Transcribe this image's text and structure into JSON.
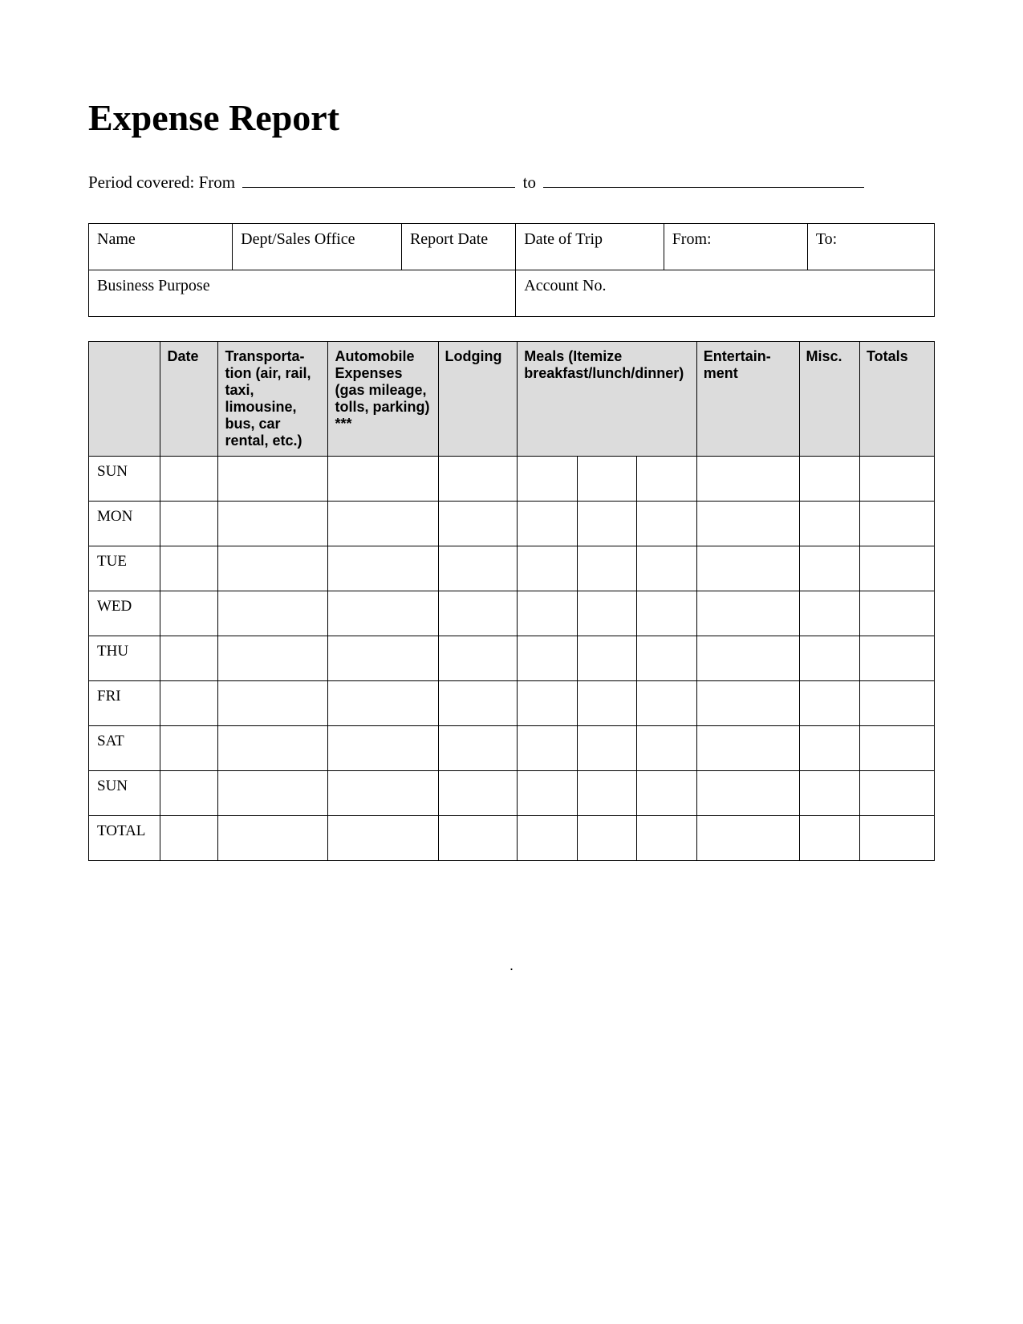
{
  "title": "Expense Report",
  "period": {
    "label_prefix": "Period covered: From",
    "label_to": "to"
  },
  "info_table": {
    "row1": {
      "name": "Name",
      "dept": "Dept/Sales Office",
      "report_date": "Report Date",
      "date_of_trip": "Date of Trip",
      "from": "From:",
      "to": "To:"
    },
    "row2": {
      "business_purpose": "Business Purpose",
      "account_no": "Account No."
    }
  },
  "expense_table": {
    "headers": {
      "blank": "",
      "date": "Date",
      "transportation": "Transporta-tion (air, rail, taxi, limousine, bus, car rental, etc.)",
      "automobile": "Automobile Expenses (gas mileage, tolls, parking) ***",
      "lodging": "Lodging",
      "meals": "Meals (Itemize breakfast/lunch/dinner)",
      "entertainment": "Entertain-ment",
      "misc": "Misc.",
      "totals": "Totals"
    },
    "rows": [
      "SUN",
      "MON",
      "TUE",
      "WED",
      "THU",
      "FRI",
      "SAT",
      "SUN",
      "TOTAL"
    ]
  },
  "footer_dot": "."
}
